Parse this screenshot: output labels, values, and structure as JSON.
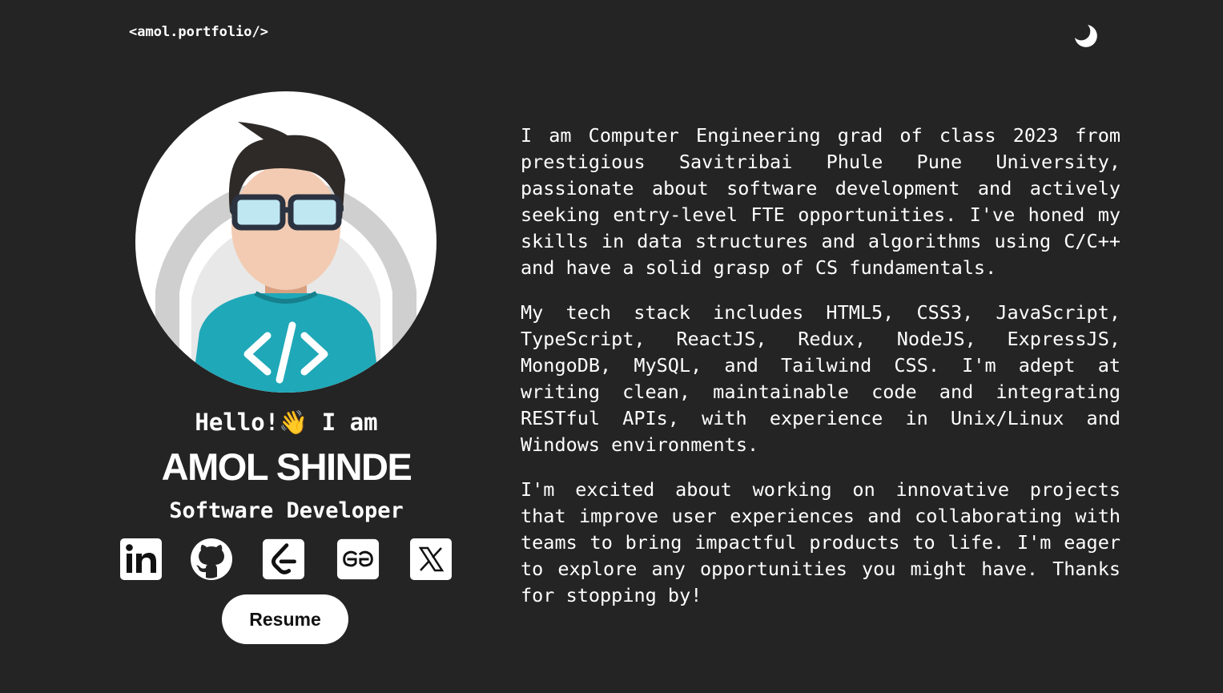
{
  "header": {
    "logo": "<amol.portfolio/>",
    "theme_toggle_icon": "moon-icon"
  },
  "profile": {
    "avatar_icon": "developer-avatar-illustration",
    "greeting": "Hello!👋 I am",
    "name": "AMOL SHINDE",
    "role": "Software Developer"
  },
  "socials": [
    {
      "icon": "linkedin-icon"
    },
    {
      "icon": "github-icon"
    },
    {
      "icon": "leetcode-icon"
    },
    {
      "icon": "geeksforgeeks-icon"
    },
    {
      "icon": "x-twitter-icon"
    }
  ],
  "resume_label": "Resume",
  "bio": {
    "p1": "I am Computer Engineering grad of class 2023 from prestigious Savitribai Phule Pune University, passionate about software development and actively seeking entry-level FTE opportunities. I've honed my skills in data structures and algorithms using C/C++ and have a solid grasp of CS fundamentals.",
    "p2": "My tech stack includes HTML5, CSS3, JavaScript, TypeScript, ReactJS, Redux, NodeJS, ExpressJS, MongoDB, MySQL, and Tailwind CSS. I'm adept at writing clean, maintainable code and integrating RESTful APIs, with experience in Unix/Linux and Windows environments.",
    "p3": "I'm excited about working on innovative projects that improve user experiences and collaborating with teams to bring impactful products to life. I'm eager to explore any opportunities you might have. Thanks for stopping by!"
  },
  "colors": {
    "background": "#242424",
    "text": "#ffffff",
    "avatar_shirt": "#1fa8b8"
  }
}
